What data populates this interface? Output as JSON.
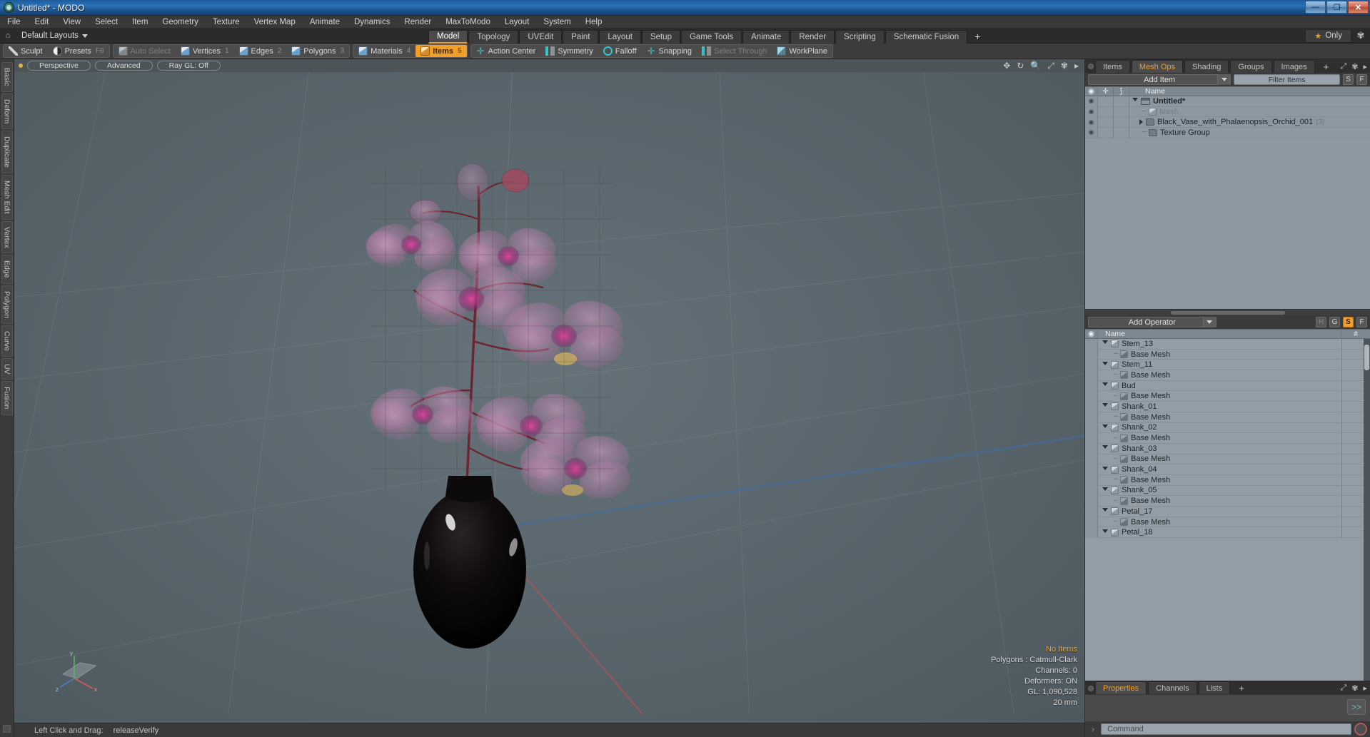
{
  "window": {
    "title": "Untitled* - MODO",
    "app_icon": "modo-logo-icon",
    "minimize": "—",
    "maximize": "❐",
    "close": "✕"
  },
  "menubar": {
    "items": [
      "File",
      "Edit",
      "View",
      "Select",
      "Item",
      "Geometry",
      "Texture",
      "Vertex Map",
      "Animate",
      "Dynamics",
      "Render",
      "MaxToModo",
      "Layout",
      "System",
      "Help"
    ]
  },
  "layoutbar": {
    "home_icon": "home-icon",
    "preset_label": "Default Layouts",
    "tabs": [
      {
        "label": "Model",
        "active": true
      },
      {
        "label": "Topology",
        "active": false
      },
      {
        "label": "UVEdit",
        "active": false
      },
      {
        "label": "Paint",
        "active": false
      },
      {
        "label": "Layout",
        "active": false
      },
      {
        "label": "Setup",
        "active": false
      },
      {
        "label": "Game Tools",
        "active": false
      },
      {
        "label": "Animate",
        "active": false
      },
      {
        "label": "Render",
        "active": false
      },
      {
        "label": "Scripting",
        "active": false
      },
      {
        "label": "Schematic Fusion",
        "active": false
      }
    ],
    "add_tab": "+",
    "only_label": "Only",
    "star_icon": "star-icon",
    "gear_icon": "gear-icon"
  },
  "toolbar": {
    "groups": [
      {
        "items": [
          {
            "label": "Sculpt",
            "icon": "sculpt-icon",
            "sub": "",
            "state": "normal"
          },
          {
            "label": "Presets",
            "icon": "presets-sphere-icon",
            "sub": "F6",
            "state": "normal"
          }
        ]
      },
      {
        "items": [
          {
            "label": "Auto Select",
            "icon": "cube-gray-icon",
            "sub": "",
            "state": "dim"
          },
          {
            "label": "Vertices",
            "icon": "cube-blue-icon",
            "sub": "1",
            "state": "normal"
          },
          {
            "label": "Edges",
            "icon": "cube-blue-icon",
            "sub": "2",
            "state": "normal"
          },
          {
            "label": "Polygons",
            "icon": "cube-blue-icon",
            "sub": "3",
            "state": "normal"
          }
        ]
      },
      {
        "items": [
          {
            "label": "Materials",
            "icon": "cube-blue-icon",
            "sub": "4",
            "state": "normal"
          },
          {
            "label": "Items",
            "icon": "cube-orange-icon",
            "sub": "5",
            "state": "active"
          }
        ]
      },
      {
        "items": [
          {
            "label": "Action Center",
            "icon": "action-center-icon",
            "sub": "",
            "state": "normal"
          },
          {
            "label": "Symmetry",
            "icon": "symmetry-icon",
            "sub": "",
            "state": "normal"
          },
          {
            "label": "Falloff",
            "icon": "falloff-icon",
            "sub": "",
            "state": "normal"
          },
          {
            "label": "Snapping",
            "icon": "snapping-icon",
            "sub": "",
            "state": "normal"
          },
          {
            "label": "Select Through",
            "icon": "select-through-icon",
            "sub": "",
            "state": "dim"
          },
          {
            "label": "WorkPlane",
            "icon": "workplane-icon",
            "sub": "",
            "state": "normal"
          }
        ]
      }
    ]
  },
  "left_rail": {
    "tabs": [
      "Basic",
      "Deform",
      "Duplicate",
      "Mesh Edit",
      "Vertex",
      "Edge",
      "Polygon",
      "Curve",
      "UV",
      "Fusion"
    ]
  },
  "viewport": {
    "header": {
      "dot": "viewport-active-dot",
      "pills": [
        "Perspective",
        "Advanced",
        "Ray GL: Off"
      ],
      "icons": [
        "move-icon",
        "rotate-icon",
        "zoom-icon",
        "fit-icon",
        "gear-icon",
        "chevron-right-icon"
      ]
    },
    "scene_description": "Black ceramic vase with pink Phalaenopsis orchid, wireframe overlay, perspective GL view",
    "info": {
      "selection": "No Items",
      "polygons": "Polygons : Catmull-Clark",
      "channels": "Channels: 0",
      "deformers": "Deformers: ON",
      "gl": "GL: 1,090,528",
      "grid_size": "20 mm"
    },
    "gizmo_axes": [
      "x",
      "y",
      "z"
    ]
  },
  "statusbar": {
    "hint_label": "Left Click and Drag:",
    "hint_value": "releaseVerify"
  },
  "right_panel": {
    "tabs": [
      {
        "label": "Items",
        "active": false
      },
      {
        "label": "Mesh Ops",
        "active": true
      },
      {
        "label": "Shading",
        "active": false
      },
      {
        "label": "Groups",
        "active": false
      },
      {
        "label": "Images",
        "active": false
      }
    ],
    "add_tab": "+",
    "expand_icon": "expand-icon",
    "gear_icon": "gear-icon",
    "chevron_icon": "chevron-right-icon",
    "add_item_label": "Add Item",
    "filter_placeholder": "Filter Items",
    "filter_buttons": [
      "S",
      "F"
    ],
    "columns": {
      "eye": "eye-icon",
      "lock": "lock-icon",
      "axis": "axis-icon",
      "name": "Name"
    },
    "items": [
      {
        "name": "Untitled*",
        "icon": "clapper-icon",
        "indent": 0,
        "bold": true,
        "muted": false,
        "arrow": "down",
        "count": ""
      },
      {
        "name": "Mesh",
        "icon": "cube-icon",
        "indent": 1,
        "bold": false,
        "muted": true,
        "arrow": "dash",
        "count": ""
      },
      {
        "name": "Black_Vase_with_Phalaenopsis_Orchid_001",
        "icon": "folder-icon",
        "indent": 1,
        "bold": false,
        "muted": false,
        "arrow": "right",
        "count": "(3)"
      },
      {
        "name": "Texture Group",
        "icon": "folder-icon",
        "indent": 1,
        "bold": false,
        "muted": false,
        "arrow": "dash",
        "count": ""
      }
    ]
  },
  "mesh_ops": {
    "add_operator_label": "Add Operator",
    "filter_buttons": [
      {
        "label": "H",
        "active": false
      },
      {
        "label": "G",
        "active": false
      },
      {
        "label": "S",
        "active": true
      },
      {
        "label": "F",
        "active": false
      }
    ],
    "columns": {
      "eye": "eye-icon",
      "name": "Name",
      "hash": "#"
    },
    "rows": [
      {
        "name": "Stem_13",
        "indent": 0,
        "arrow": "down",
        "icon": "cube-icon"
      },
      {
        "name": "Base Mesh",
        "indent": 1,
        "arrow": "dash",
        "icon": "cube-dark-icon"
      },
      {
        "name": "Stem_11",
        "indent": 0,
        "arrow": "down",
        "icon": "cube-icon"
      },
      {
        "name": "Base Mesh",
        "indent": 1,
        "arrow": "dash",
        "icon": "cube-dark-icon"
      },
      {
        "name": "Bud",
        "indent": 0,
        "arrow": "down",
        "icon": "cube-icon"
      },
      {
        "name": "Base Mesh",
        "indent": 1,
        "arrow": "dash",
        "icon": "cube-dark-icon"
      },
      {
        "name": "Shank_01",
        "indent": 0,
        "arrow": "down",
        "icon": "cube-icon"
      },
      {
        "name": "Base Mesh",
        "indent": 1,
        "arrow": "dash",
        "icon": "cube-dark-icon"
      },
      {
        "name": "Shank_02",
        "indent": 0,
        "arrow": "down",
        "icon": "cube-icon"
      },
      {
        "name": "Base Mesh",
        "indent": 1,
        "arrow": "dash",
        "icon": "cube-dark-icon"
      },
      {
        "name": "Shank_03",
        "indent": 0,
        "arrow": "down",
        "icon": "cube-icon"
      },
      {
        "name": "Base Mesh",
        "indent": 1,
        "arrow": "dash",
        "icon": "cube-dark-icon"
      },
      {
        "name": "Shank_04",
        "indent": 0,
        "arrow": "down",
        "icon": "cube-icon"
      },
      {
        "name": "Base Mesh",
        "indent": 1,
        "arrow": "dash",
        "icon": "cube-dark-icon"
      },
      {
        "name": "Shank_05",
        "indent": 0,
        "arrow": "down",
        "icon": "cube-icon"
      },
      {
        "name": "Base Mesh",
        "indent": 1,
        "arrow": "dash",
        "icon": "cube-dark-icon"
      },
      {
        "name": "Petal_17",
        "indent": 0,
        "arrow": "down",
        "icon": "cube-icon"
      },
      {
        "name": "Base Mesh",
        "indent": 1,
        "arrow": "dash",
        "icon": "cube-dark-icon"
      },
      {
        "name": "Petal_18",
        "indent": 0,
        "arrow": "down",
        "icon": "cube-icon"
      }
    ]
  },
  "properties_panel": {
    "tabs": [
      {
        "label": "Properties",
        "active": true
      },
      {
        "label": "Channels",
        "active": false
      },
      {
        "label": "Lists",
        "active": false
      }
    ],
    "add_tab": "+",
    "expand_icon": "expand-icon",
    "gear_icon": "gear-icon",
    "chevron_icon": "chevron-right-icon",
    "more_button": ">>"
  },
  "command_bar": {
    "prompt_icon": "chevron-right-icon",
    "placeholder": "Command",
    "record_icon": "record-icon"
  },
  "colors": {
    "accent": "#f0a02a",
    "title_blue": "#2a72b8",
    "panel_bg": "#3a3a3a",
    "list_bg": "#8d98a1",
    "teal_icon": "#36c3c8"
  }
}
